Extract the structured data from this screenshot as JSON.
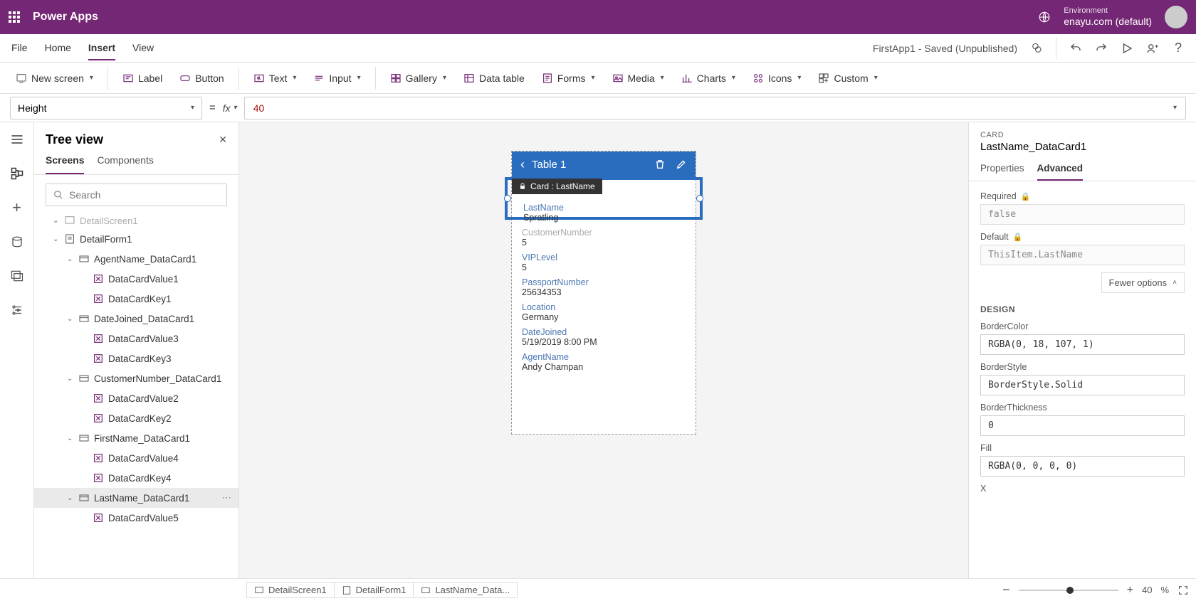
{
  "topbar": {
    "app_title": "Power Apps",
    "env_label": "Environment",
    "env_value": "enayu.com (default)"
  },
  "menubar": {
    "items": [
      "File",
      "Home",
      "Insert",
      "View"
    ],
    "active_index": 2,
    "status": "FirstApp1 - Saved (Unpublished)"
  },
  "ribbon": {
    "new_screen": "New screen",
    "label": "Label",
    "button": "Button",
    "text": "Text",
    "input": "Input",
    "gallery": "Gallery",
    "data_table": "Data table",
    "forms": "Forms",
    "media": "Media",
    "charts": "Charts",
    "icons": "Icons",
    "custom": "Custom"
  },
  "formula": {
    "property": "Height",
    "fx": "fx",
    "value": "40"
  },
  "tree": {
    "title": "Tree view",
    "tabs": [
      "Screens",
      "Components"
    ],
    "active_tab": 0,
    "search_placeholder": "Search",
    "cutoff_top": "DetailScreen1",
    "items": [
      {
        "label": "DetailForm1",
        "indent": 1,
        "caret": true,
        "icon": "form"
      },
      {
        "label": "AgentName_DataCard1",
        "indent": 2,
        "caret": true,
        "icon": "card"
      },
      {
        "label": "DataCardValue1",
        "indent": 3,
        "icon": "control"
      },
      {
        "label": "DataCardKey1",
        "indent": 3,
        "icon": "control"
      },
      {
        "label": "DateJoined_DataCard1",
        "indent": 2,
        "caret": true,
        "icon": "card"
      },
      {
        "label": "DataCardValue3",
        "indent": 3,
        "icon": "control"
      },
      {
        "label": "DataCardKey3",
        "indent": 3,
        "icon": "control"
      },
      {
        "label": "CustomerNumber_DataCard1",
        "indent": 2,
        "caret": true,
        "icon": "card"
      },
      {
        "label": "DataCardValue2",
        "indent": 3,
        "icon": "control"
      },
      {
        "label": "DataCardKey2",
        "indent": 3,
        "icon": "control"
      },
      {
        "label": "FirstName_DataCard1",
        "indent": 2,
        "caret": true,
        "icon": "card"
      },
      {
        "label": "DataCardValue4",
        "indent": 3,
        "icon": "control"
      },
      {
        "label": "DataCardKey4",
        "indent": 3,
        "icon": "control"
      },
      {
        "label": "LastName_DataCard1",
        "indent": 2,
        "caret": true,
        "icon": "card",
        "selected": true
      },
      {
        "label": "DataCardValue5",
        "indent": 3,
        "icon": "control"
      }
    ]
  },
  "canvas": {
    "header_title": "Table 1",
    "tooltip": "Card : LastName",
    "fields": [
      {
        "label": "LastName",
        "value": "Spratling",
        "selected": true
      },
      {
        "label": "CustomerNumber",
        "value": "5"
      },
      {
        "label": "VIPLevel",
        "value": "5"
      },
      {
        "label": "PassportNumber",
        "value": "25634353"
      },
      {
        "label": "Location",
        "value": "Germany"
      },
      {
        "label": "DateJoined",
        "value": "5/19/2019 8:00 PM"
      },
      {
        "label": "AgentName",
        "value": "Andy Champan"
      }
    ]
  },
  "rightpanel": {
    "super": "CARD",
    "title": "LastName_DataCard1",
    "tabs": [
      "Properties",
      "Advanced"
    ],
    "active_tab": 1,
    "required_label": "Required",
    "required_value": "false",
    "default_label": "Default",
    "default_value": "ThisItem.LastName",
    "fewer_options": "Fewer options",
    "design_label": "DESIGN",
    "props": [
      {
        "label": "BorderColor",
        "value": "RGBA(0, 18, 107, 1)"
      },
      {
        "label": "BorderStyle",
        "value": "BorderStyle.Solid"
      },
      {
        "label": "BorderThickness",
        "value": "0"
      },
      {
        "label": "Fill",
        "value": "RGBA(0, 0, 0, 0)"
      }
    ],
    "last_prop": "X"
  },
  "bottombar": {
    "breadcrumb": [
      "DetailScreen1",
      "DetailForm1",
      "LastName_Data..."
    ],
    "zoom_value": "40",
    "zoom_unit": "%"
  }
}
